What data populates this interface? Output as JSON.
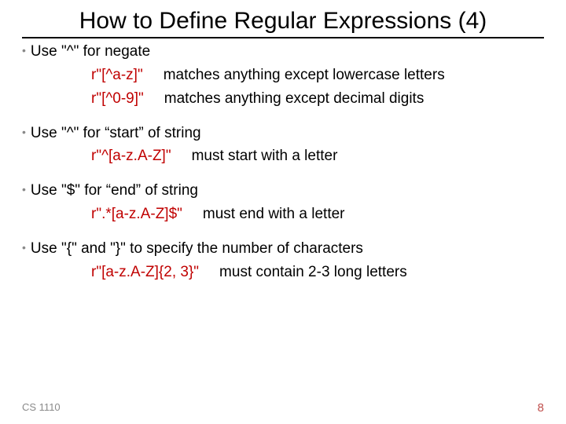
{
  "title": "How to Define Regular Expressions (4)",
  "bullets": [
    {
      "text": "Use \"^\"  for negate",
      "examples": [
        {
          "code": "r\"[^a-z]\"",
          "desc": "matches anything except lowercase letters"
        },
        {
          "code": "r\"[^0-9]\"",
          "desc": "matches anything except decimal digits"
        }
      ]
    },
    {
      "text": "Use \"^\"  for “start” of string",
      "examples": [
        {
          "code": "r\"^[a-z.A-Z]\"",
          "desc": "must start with a letter"
        }
      ]
    },
    {
      "text": "Use \"$\"  for “end” of string",
      "examples": [
        {
          "code": "r\".*[a-z.A-Z]$\"",
          "desc": "must end with a letter"
        }
      ]
    },
    {
      "text": "Use \"{\" and \"}\"  to specify the number of characters",
      "examples": [
        {
          "code": "r\"[a-z.A-Z]{2, 3}\"",
          "desc": "must contain 2-3 long letters"
        }
      ]
    }
  ],
  "footer": {
    "left": "CS 1110",
    "right": "8"
  }
}
